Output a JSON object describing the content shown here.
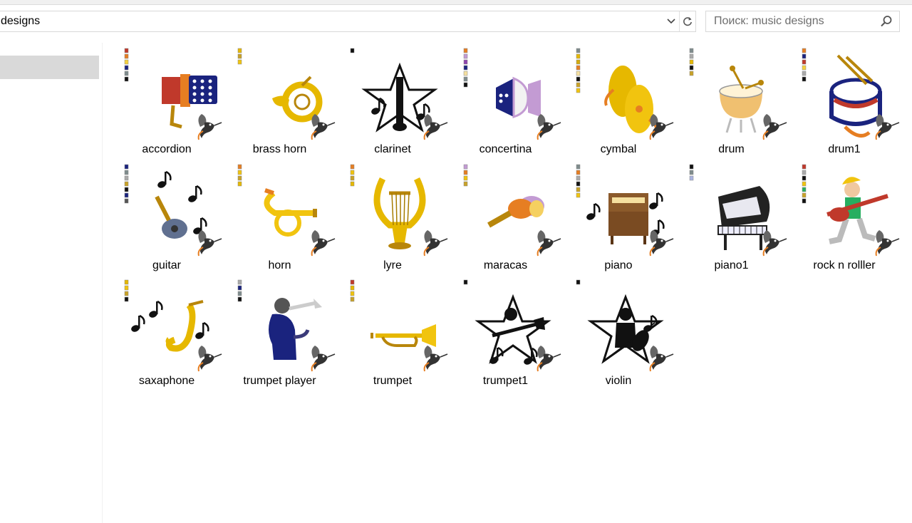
{
  "address_bar": {
    "path_text": "designs"
  },
  "search": {
    "placeholder": "Поиск: music designs"
  },
  "icons": {
    "dropdown": "chevron-down-icon",
    "refresh": "refresh-icon",
    "search": "search-icon",
    "overlay": "hummingbird-icon"
  },
  "files": [
    {
      "name": "accordion",
      "swatches": [
        "#c0392b",
        "#e67e22",
        "#f4d03f",
        "#1a237e",
        "#7f8c8d",
        "#111111"
      ]
    },
    {
      "name": "brass horn",
      "swatches": [
        "#e6b800",
        "#c9a227",
        "#f1c40f"
      ]
    },
    {
      "name": "clarinet",
      "swatches": [
        "#111111"
      ]
    },
    {
      "name": "concertina",
      "swatches": [
        "#e67e22",
        "#c39bd3",
        "#8e44ad",
        "#1a237e",
        "#f5e0a0",
        "#7f8c8d",
        "#111111"
      ]
    },
    {
      "name": "cymbal",
      "swatches": [
        "#7f8c8d",
        "#e6b800",
        "#d4ac0d",
        "#e67e22",
        "#f5e0a0",
        "#111111",
        "#c9a227",
        "#f1c40f"
      ]
    },
    {
      "name": "drum",
      "swatches": [
        "#7f8c8d",
        "#aaaaaa",
        "#e6b800",
        "#111111",
        "#c9a227"
      ]
    },
    {
      "name": "drum1",
      "swatches": [
        "#e67e22",
        "#1a237e",
        "#c0392b",
        "#f4d03f",
        "#aaaaaa",
        "#111111"
      ]
    },
    {
      "name": "guitar",
      "swatches": [
        "#1a237e",
        "#7f8c8d",
        "#aaaaaa",
        "#c9a227",
        "#111111",
        "#1a237e",
        "#555555"
      ]
    },
    {
      "name": "horn",
      "swatches": [
        "#e67e22",
        "#f1c40f",
        "#c9a227",
        "#e6b800"
      ]
    },
    {
      "name": "lyre",
      "swatches": [
        "#e67e22",
        "#f1c40f",
        "#c9a227",
        "#e6b800"
      ]
    },
    {
      "name": "maracas",
      "swatches": [
        "#c39bd3",
        "#e67e22",
        "#f1c40f",
        "#c9a227"
      ]
    },
    {
      "name": "piano",
      "swatches": [
        "#7f8c8d",
        "#e67e22",
        "#aaaaaa",
        "#111111",
        "#c9a227",
        "#f1c40f"
      ]
    },
    {
      "name": "piano1",
      "swatches": [
        "#111111",
        "#7f8c8d",
        "#aab4e0"
      ]
    },
    {
      "name": "rock n rolller",
      "swatches": [
        "#c0392b",
        "#aaaaaa",
        "#111111",
        "#f1c40f",
        "#27ae60",
        "#c9a227",
        "#111111"
      ]
    },
    {
      "name": "saxaphone",
      "swatches": [
        "#e6b800",
        "#f1c40f",
        "#c9a227",
        "#111111"
      ]
    },
    {
      "name": "trumpet player",
      "swatches": [
        "#aaaaaa",
        "#1a237e",
        "#7f8c8d",
        "#111111"
      ]
    },
    {
      "name": "trumpet",
      "swatches": [
        "#c0392b",
        "#e6b800",
        "#f1c40f",
        "#c9a227"
      ]
    },
    {
      "name": "trumpet1",
      "swatches": [
        "#111111"
      ]
    },
    {
      "name": "violin",
      "swatches": [
        "#111111"
      ]
    }
  ]
}
